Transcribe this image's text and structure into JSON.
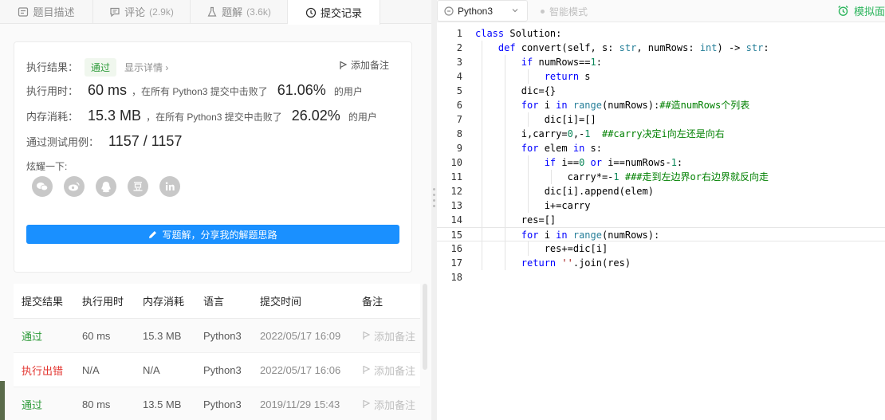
{
  "tabs": [
    {
      "label": "题目描述",
      "count": "",
      "icon": "description-icon"
    },
    {
      "label": "评论",
      "count": "(2.9k)",
      "icon": "comment-icon"
    },
    {
      "label": "题解",
      "count": "(3.6k)",
      "icon": "flask-icon"
    },
    {
      "label": "提交记录",
      "count": "",
      "icon": "clock-icon",
      "active": true
    }
  ],
  "result": {
    "exec_result_label": "执行结果：",
    "status": "通过",
    "show_details": "显示详情",
    "add_note": "添加备注",
    "runtime_label": "执行用时：",
    "runtime_value": "60 ms",
    "runtime_text": "，在所有 Python3 提交中击败了",
    "runtime_percent": "61.06%",
    "runtime_suffix": "的用户",
    "memory_label": "内存消耗：",
    "memory_value": "15.3 MB",
    "memory_text": "，在所有 Python3 提交中击败了",
    "memory_percent": "26.02%",
    "memory_suffix": "的用户",
    "testcases_label": "通过测试用例：",
    "testcases_value": "1157 / 1157",
    "share_label": "炫耀一下:",
    "share_icons": [
      "wechat-icon",
      "weibo-icon",
      "qq-icon",
      "douban-icon",
      "linkedin-icon"
    ],
    "write_solution": "写题解，分享我的解题思路"
  },
  "submissions": {
    "headers": [
      "提交结果",
      "执行用时",
      "内存消耗",
      "语言",
      "提交时间",
      "备注"
    ],
    "rows": [
      {
        "status": "通过",
        "ok": true,
        "runtime": "60 ms",
        "memory": "15.3 MB",
        "lang": "Python3",
        "time": "2022/05/17 16:09",
        "note": "添加备注"
      },
      {
        "status": "执行出错",
        "ok": false,
        "runtime": "N/A",
        "memory": "N/A",
        "lang": "Python3",
        "time": "2022/05/17 16:06",
        "note": "添加备注"
      },
      {
        "status": "通过",
        "ok": true,
        "runtime": "80 ms",
        "memory": "13.5 MB",
        "lang": "Python3",
        "time": "2019/11/29 15:43",
        "note": "添加备注"
      }
    ]
  },
  "editor_toolbar": {
    "language": "Python3",
    "smart_mode": "智能模式",
    "mock_interview": "模拟面试"
  },
  "code_lines": [
    "class Solution:",
    "    def convert(self, s: str, numRows: int) -> str:",
    "        if numRows==1:",
    "            return s",
    "        dic={}",
    "        for i in range(numRows):##造numRows个列表",
    "            dic[i]=[]",
    "        i,carry=0,-1  ##carry决定i向左还是向右",
    "        for elem in s:",
    "            if i==0 or i==numRows-1:",
    "                carry*=-1 ###走到左边界or右边界就反向走",
    "            dic[i].append(elem)",
    "            i+=carry",
    "        res=[]",
    "        for i in range(numRows):",
    "            res+=dic[i]",
    "        return ''.join(res)",
    ""
  ],
  "colors": {
    "accent": "#1a90ff",
    "success": "#2e9b3a",
    "error": "#e3342f",
    "keyword": "#0000ff",
    "builtin": "#267f99",
    "comment": "#008000",
    "number": "#098658"
  }
}
